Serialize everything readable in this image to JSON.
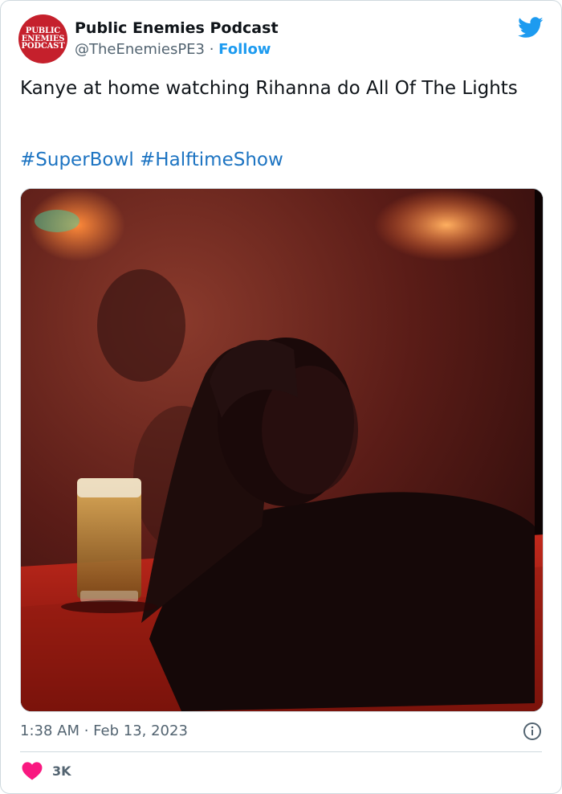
{
  "author": {
    "avatar_lines": [
      "PUBLIC",
      "ENEMIES",
      "PODCAST"
    ],
    "name": "Public Enemies Podcast",
    "handle": "@TheEnemiesPE3",
    "separator": " · ",
    "follow_label": "Follow"
  },
  "tweet": {
    "text": "Kanye at home watching Rihanna do All Of The Lights",
    "hashtags": [
      "#SuperBowl",
      "#HalftimeShow"
    ]
  },
  "meta": {
    "timestamp": "1:38 AM · Feb 13, 2023",
    "likes": "3K"
  },
  "icons": {
    "brand": "twitter-bird-icon",
    "info": "info-icon",
    "like": "heart-icon"
  },
  "colors": {
    "brand_blue": "#1d9bf0",
    "hashtag_blue": "#1d74c2",
    "heart": "#f91880",
    "avatar_red": "#c5202c",
    "muted": "#536471"
  }
}
